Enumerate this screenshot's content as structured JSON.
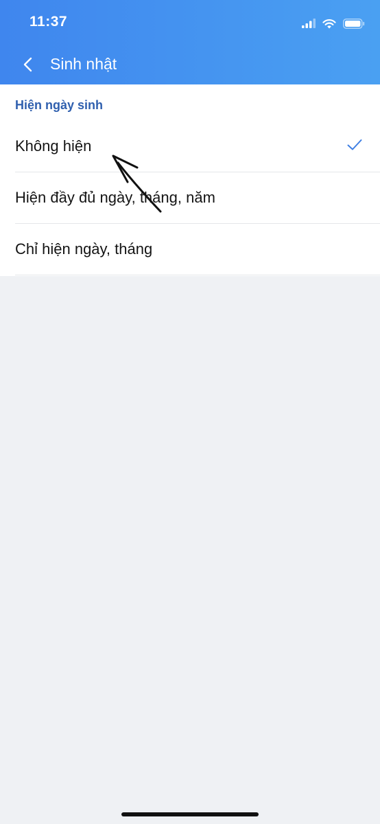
{
  "status_bar": {
    "time": "11:37",
    "icons": [
      "signal-icon",
      "wifi-icon",
      "battery-icon"
    ]
  },
  "nav": {
    "back_icon": "chevron-left-icon",
    "title": "Sinh nhật"
  },
  "section": {
    "header": "Hiện ngày sinh"
  },
  "options": [
    {
      "label": "Không hiện",
      "selected": true
    },
    {
      "label": "Hiện đầy đủ ngày, tháng, năm",
      "selected": false
    },
    {
      "label": "Chỉ hiện ngày, tháng",
      "selected": false
    }
  ],
  "colors": {
    "header_gradient_start": "#3f86ee",
    "header_gradient_end": "#4aa0f2",
    "section_header": "#2f5fae",
    "check": "#3f7fe3",
    "background": "#eff1f4"
  }
}
